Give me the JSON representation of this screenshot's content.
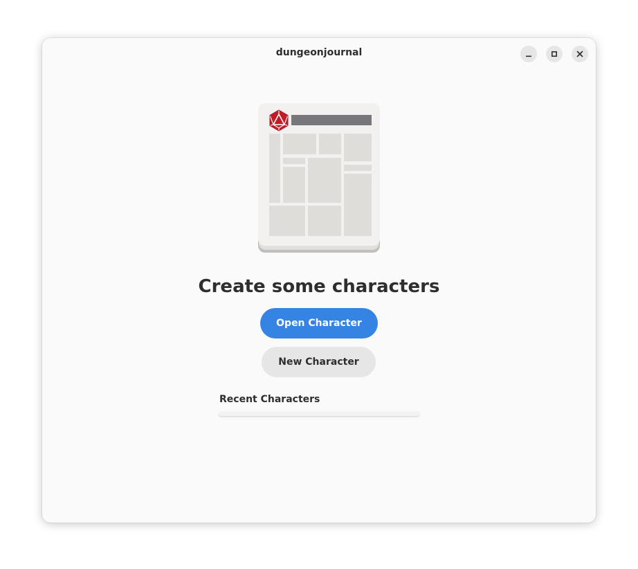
{
  "window": {
    "title": "dungeonjournal"
  },
  "window_controls": {
    "minimize_icon": "minimize-icon",
    "maximize_icon": "maximize-icon",
    "close_icon": "close-icon"
  },
  "illustration": {
    "icon": "character-sheet-illustration",
    "die_icon": "d20-icon",
    "colors": {
      "sheet": "#f2f1f0",
      "cells": "#deddda",
      "bar": "#77767b",
      "die": "#c01c28"
    }
  },
  "main": {
    "heading": "Create some characters",
    "open_button": "Open Character",
    "new_button": "New Character",
    "recent_label": "Recent Characters"
  },
  "colors": {
    "accent": "#3584e4",
    "window_bg": "#fafafa",
    "text": "#2e2e2e"
  }
}
